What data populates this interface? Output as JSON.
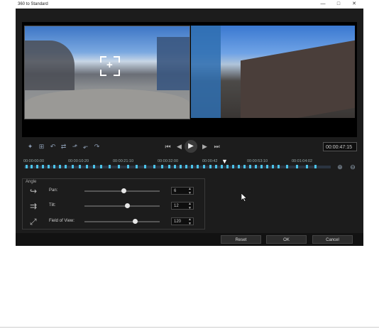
{
  "window": {
    "title": "360 to Standard",
    "minimize": "—",
    "maximize": "□",
    "close": "✕"
  },
  "toolbar": {
    "icons": [
      "cursor-tool",
      "add-keyframe",
      "remove-keyframe",
      "prev-keyframe",
      "next-keyframe",
      "reverse-keyframe",
      "copy-keyframe",
      "paste-keyframe"
    ],
    "timecode": "00:00:47:15"
  },
  "playback": {
    "buttons": [
      "go-to-start",
      "previous-frame",
      "play",
      "next-frame",
      "go-to-end"
    ]
  },
  "timeline": {
    "ticks": [
      "00:00:00:00",
      "00:00:10:20",
      "00:00:21:10",
      "00:00:32:00",
      "00:00:42",
      "00:00:53:10",
      "00:01:04:02"
    ]
  },
  "angle": {
    "title": "Angle",
    "pan": {
      "label": "Pan:",
      "value": "6",
      "level": 0.52
    },
    "tilt": {
      "label": "Tilt:",
      "value": "12",
      "level": 0.57
    },
    "fov": {
      "label": "Field of View:",
      "value": "120",
      "level": 0.67
    }
  },
  "footer": {
    "reset": "Reset",
    "ok": "OK",
    "cancel": "Cancel"
  },
  "colors": {
    "accent": "#4cc3e8",
    "background": "#1c1c1c"
  }
}
